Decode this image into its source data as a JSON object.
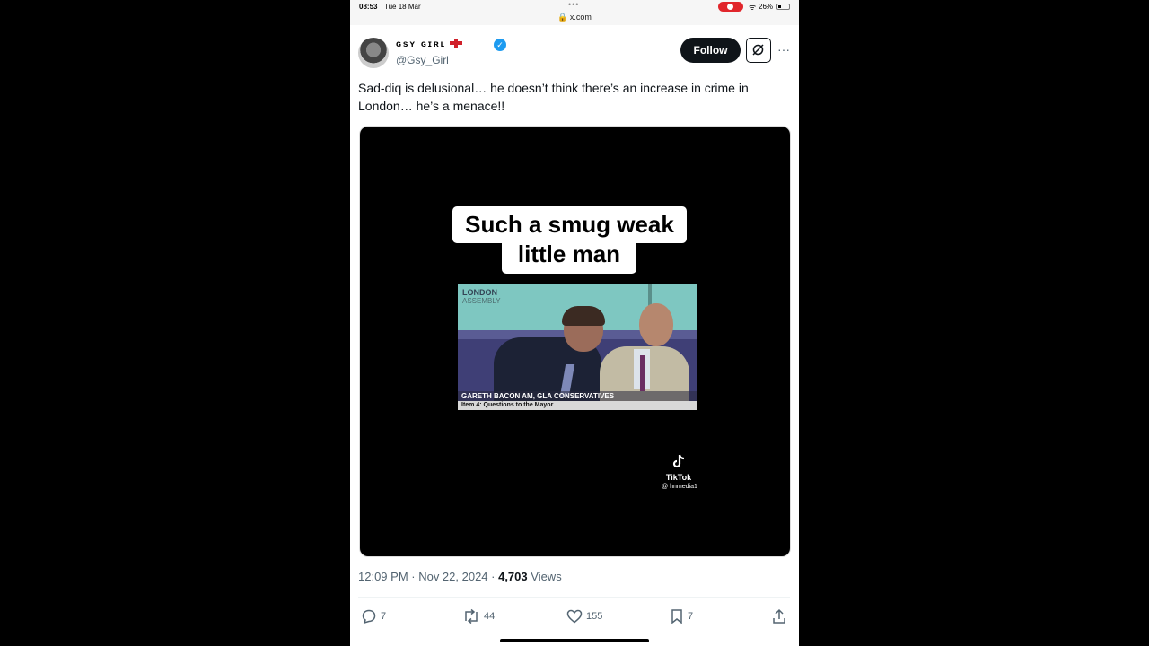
{
  "status_bar": {
    "time": "08:53",
    "date": "Tue 18 Mar",
    "dots": "•••",
    "url": "x.com",
    "battery": "26%"
  },
  "tweet": {
    "display_name": "ɢsʏ ɢɪʀʟ",
    "handle": "@Gsy_Girl",
    "follow_label": "Follow",
    "more": "···",
    "text": "Sad-diq is delusional… he doesn’t think there’s an increase in crime in London… he’s a menace!!",
    "media": {
      "caption_line1": "Such a smug weak",
      "caption_line2": "little man",
      "video_brand_line1": "LONDON",
      "video_brand_line2": "ASSEMBLY",
      "lower_third_name": "GARETH BACON AM, GLA CONSERVATIVES",
      "lower_third_item": "Item 4: Questions to the Mayor",
      "watermark_brand": "TikTok",
      "watermark_handle": "@ hnmedia1"
    },
    "timestamp": "12:09 PM · Nov 22, 2024 · ",
    "views_count": "4,703",
    "views_label": " Views",
    "replies": "7",
    "reposts": "44",
    "likes": "155",
    "bookmarks": "7"
  },
  "colors": {
    "verified": "#1d9bf0",
    "record_indicator": "#e1262c",
    "secondary_text": "#536471"
  }
}
